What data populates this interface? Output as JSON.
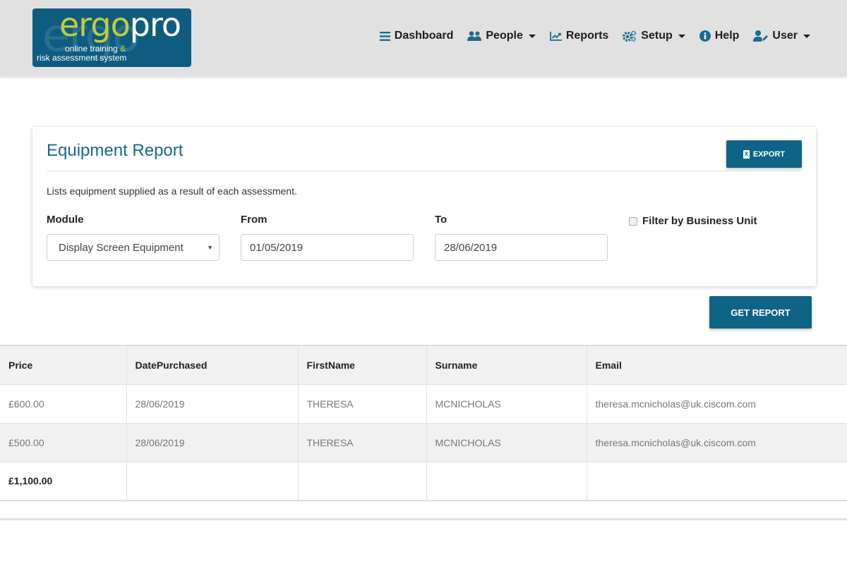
{
  "logo": {
    "ghost": "ergo",
    "ergo": "ergo",
    "pro": "pro",
    "tagline_1": "online training",
    "tagline_amp": "&",
    "tagline_2": "risk assessment system"
  },
  "nav": {
    "items": [
      {
        "label": "Dashboard",
        "icon": "bars-icon",
        "dropdown": false
      },
      {
        "label": "People",
        "icon": "users-icon",
        "dropdown": true
      },
      {
        "label": "Reports",
        "icon": "chart-line-icon",
        "dropdown": false
      },
      {
        "label": "Setup",
        "icon": "cogs-icon",
        "dropdown": true
      },
      {
        "label": "Help",
        "icon": "info-circle-icon",
        "dropdown": false
      },
      {
        "label": "User",
        "icon": "user-edit-icon",
        "dropdown": true
      }
    ]
  },
  "report": {
    "title": "Equipment Report",
    "export_label": "EXPORT",
    "export_icon_glyph": "X",
    "description": "Lists equipment supplied as a result of each assessment.",
    "module_label": "Module",
    "module_value": "Display Screen Equipment",
    "from_label": "From",
    "from_value": "01/05/2019",
    "to_label": "To",
    "to_value": "28/06/2019",
    "filter_label": "Filter by Business Unit",
    "filter_checked": false,
    "get_report_label": "GET REPORT"
  },
  "table": {
    "columns": [
      "Price",
      "DatePurchased",
      "FirstName",
      "Surname",
      "Email"
    ],
    "rows": [
      [
        "£600.00",
        "28/06/2019",
        "THERESA",
        "MCNICHOLAS",
        "theresa.mcnicholas@uk.ciscom.com"
      ],
      [
        "£500.00",
        "28/06/2019",
        "THERESA",
        "MCNICHOLAS",
        "theresa.mcnicholas@uk.ciscom.com"
      ]
    ],
    "total": [
      "£1,100.00",
      "",
      "",
      "",
      ""
    ]
  },
  "colors": {
    "brand": "#0e6487",
    "accent_green": "#c2cd3b",
    "title": "#17698f",
    "navbar_bg": "#e1e1e1"
  }
}
